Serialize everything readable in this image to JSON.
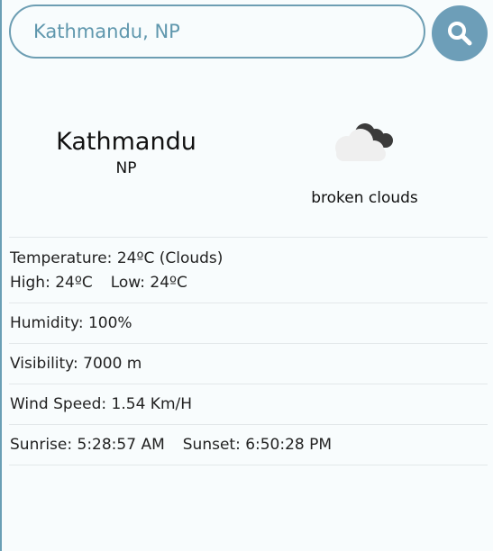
{
  "search": {
    "value": "Kathmandu, NP"
  },
  "location": {
    "city": "Kathmandu",
    "country": "NP"
  },
  "weather": {
    "icon": "broken-clouds-icon",
    "description": "broken clouds"
  },
  "details": {
    "temperature": "Temperature: 24ºC (Clouds)",
    "high": "High: 24ºC",
    "low": "Low: 24ºC",
    "humidity": "Humidity: 100%",
    "visibility": "Visibility: 7000 m",
    "wind": "Wind Speed: 1.54 Km/H",
    "sunrise": "Sunrise: 5:28:57 AM",
    "sunset": "Sunset: 6:50:28 PM"
  },
  "colors": {
    "accent": "#6d9eb8",
    "background": "#f8fcfd"
  }
}
